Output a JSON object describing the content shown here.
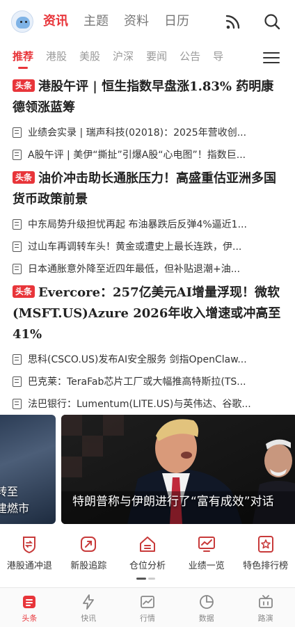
{
  "header": {
    "tabs": [
      {
        "label": "资讯",
        "active": true
      },
      {
        "label": "主题"
      },
      {
        "label": "资料"
      },
      {
        "label": "日历"
      }
    ],
    "icons": [
      "avatar",
      "rss-icon",
      "search-icon"
    ]
  },
  "subnav": {
    "tabs": [
      "推荐",
      "港股",
      "美股",
      "沪深",
      "要闻",
      "公告",
      "导"
    ],
    "active": "推荐",
    "menu_icon": "menu-icon"
  },
  "news": [
    {
      "tag": "头条",
      "headline": "港股午评 | 恒生指数早盘涨1.83% 药明康德领涨蓝筹",
      "items": [
        "业绩会实录 | 瑞声科技(02018)：2025年营收创...",
        "A股午评 | 美伊“撕扯”引爆A股“心电图”！指数巨..."
      ]
    },
    {
      "tag": "头条",
      "headline": "油价冲击助长通胀压力！高盛重估亚洲多国货币政策前景",
      "items": [
        "中东局势升级担忧再起 布油暴跌后反弹4%逼近1...",
        "过山车再调转车头！黄金或遭史上最长连跌，伊...",
        "日本通胀意外降至近四年最低，但补贴退潮+油..."
      ]
    },
    {
      "tag": "头条",
      "headline": "Evercore：257亿美元AI增量浮现！微软(MSFT.US)Azure 2026年收入增速或冲高至41%",
      "items": [
        "思科(CSCO.US)发布AI安全服务 剑指OpenClaw...",
        "巴克莱：TeraFab芯片工厂或大幅推高特斯拉(TS...",
        "法巴银行：Lumentum(LITE.US)与英伟达、谷歌..."
      ]
    }
  ],
  "carousel": {
    "left_caption": "转至\n建燃市",
    "main_caption": "特朗普称与伊朗进行了“富有成效”对话"
  },
  "quick_entries": [
    {
      "label": "港股通冲退",
      "icon": "shield-icon"
    },
    {
      "label": "新股追踪",
      "icon": "rocket-icon"
    },
    {
      "label": "仓位分析",
      "icon": "house-icon"
    },
    {
      "label": "业绩一览",
      "icon": "monitor-chart-icon"
    },
    {
      "label": "特色排行榜",
      "icon": "star-icon"
    }
  ],
  "bottom_nav": [
    {
      "label": "头条",
      "icon": "headline-icon",
      "active": true
    },
    {
      "label": "快讯",
      "icon": "lightning-icon"
    },
    {
      "label": "行情",
      "icon": "chart-icon"
    },
    {
      "label": "数据",
      "icon": "pie-icon"
    },
    {
      "label": "路演",
      "icon": "tv-icon"
    }
  ],
  "colors": {
    "accent": "#e8353a",
    "text": "#222222",
    "muted": "#999999"
  }
}
